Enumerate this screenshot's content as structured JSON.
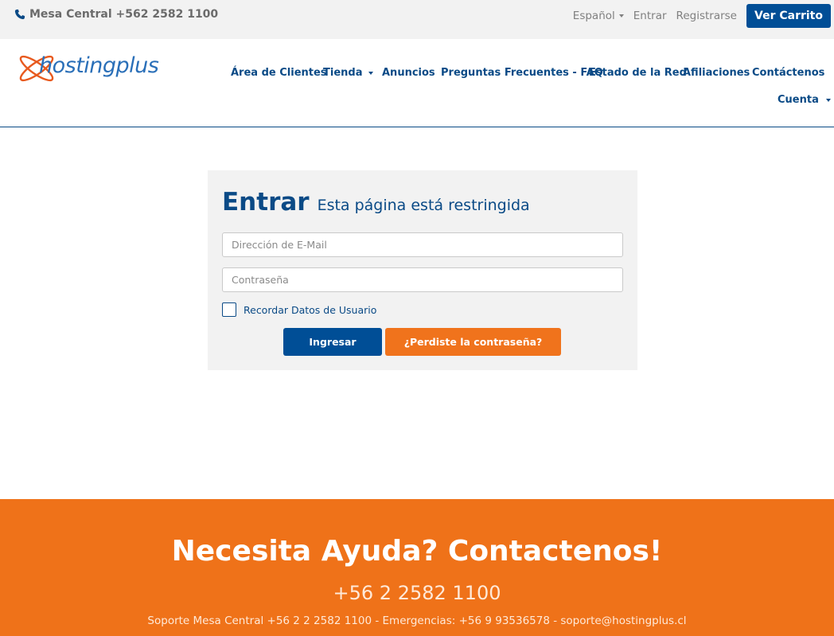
{
  "topbar": {
    "phone_text": "Mesa Central +562 2582 1100",
    "language": "Español",
    "login": "Entrar",
    "register": "Registrarse",
    "cart": "Ver Carrito"
  },
  "brand": {
    "logo_text": "hostingplus"
  },
  "nav": {
    "items": [
      {
        "label": "Área de Clientes"
      },
      {
        "label": "Tienda"
      },
      {
        "label": "Anuncios"
      },
      {
        "label": "Preguntas Frecuentes - FAQ"
      },
      {
        "label": "Estado de la Red"
      },
      {
        "label": "Afiliaciones"
      },
      {
        "label": "Contáctenos"
      },
      {
        "label": "Cuenta"
      }
    ]
  },
  "login": {
    "title": "Entrar",
    "subtitle": "Esta página está restringida",
    "email_placeholder": "Dirección de E-Mail",
    "password_placeholder": "Contraseña",
    "remember_label": "Recordar Datos de Usuario",
    "submit_label": "Ingresar",
    "forgot_label": "¿Perdiste la contraseña?"
  },
  "footer": {
    "title": "Necesita Ayuda? Contactenos!",
    "phone": "+56 2 2582 1100",
    "contact_line": "Soporte Mesa Central +56 2 2 2582 1100 - Emergencias: +56 9 93536578 - soporte@hostingplus.cl"
  },
  "colors": {
    "primary": "#004e96",
    "accent": "#f0731c",
    "topbar_bg": "#f2f2f2"
  }
}
